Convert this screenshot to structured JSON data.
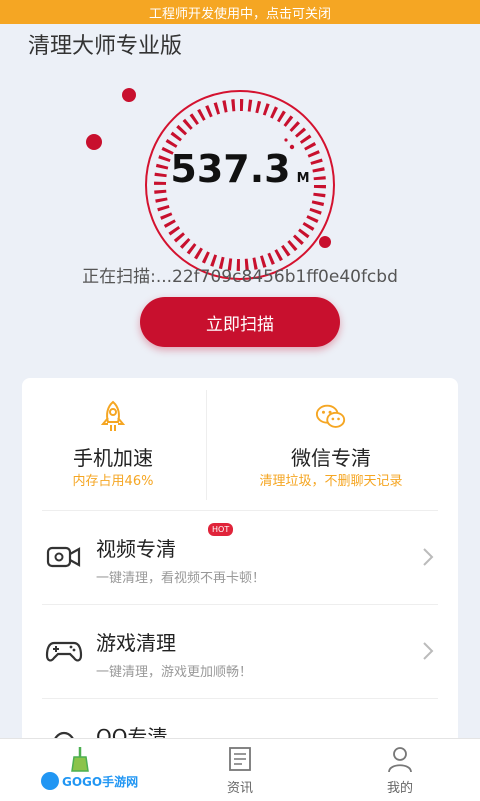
{
  "dev_banner": "工程师开发使用中，点击可关闭",
  "app": {
    "title": "清理大师专业版"
  },
  "gauge": {
    "value": "537.3",
    "unit": "M"
  },
  "scan": {
    "status": "正在扫描:...22f709c8456b1ff0e40fcbd",
    "button_label": "立即扫描"
  },
  "features": [
    {
      "title": "手机加速",
      "sub": "内存占用46%",
      "icon": "rocket-icon"
    },
    {
      "title": "微信专清",
      "sub": "清理垃圾，不删聊天记录",
      "icon": "wechat-icon"
    }
  ],
  "rows": [
    {
      "title": "视频专清",
      "sub": "一键清理，看视频不再卡顿！",
      "badge": "HOT",
      "icon": "video-camera-icon"
    },
    {
      "title": "游戏清理",
      "sub": "一键清理，游戏更加顺畅！",
      "icon": "gamepad-icon"
    },
    {
      "title": "QQ专清",
      "icon": "qq-icon"
    }
  ],
  "tabs": [
    {
      "label": "",
      "icon": "broom-icon"
    },
    {
      "label": "资讯",
      "icon": "news-icon"
    },
    {
      "label": "我的",
      "icon": "user-icon"
    }
  ],
  "colors": {
    "accent": "#c8102e",
    "banner": "#f5a623",
    "subtext_orange": "#f5a623"
  },
  "logo_text": "GOGO手游网"
}
